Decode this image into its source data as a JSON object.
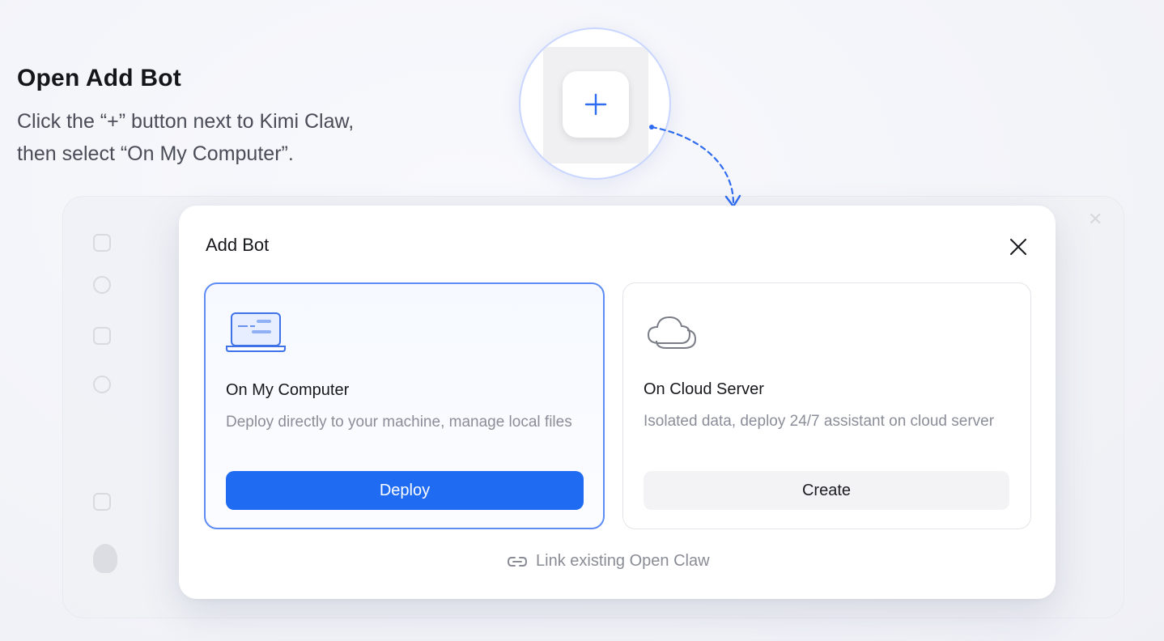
{
  "instruction": {
    "title": "Open Add Bot",
    "line1": "Click the “+” button next to Kimi Claw,",
    "line2": "then select “On My Computer”."
  },
  "zoom": {
    "button_icon": "plus-icon",
    "accent": "#2f6cf0"
  },
  "modal": {
    "title": "Add Bot",
    "close_icon": "close-icon",
    "cards": [
      {
        "id": "computer",
        "icon": "laptop-icon",
        "title": "On My Computer",
        "description": "Deploy directly to your machine, manage local files",
        "button": "Deploy",
        "selected": true
      },
      {
        "id": "cloud",
        "icon": "cloud-icon",
        "title": "On Cloud Server",
        "description": "Isolated data, deploy 24/7 assistant on cloud server",
        "button": "Create",
        "selected": false
      }
    ],
    "link": {
      "icon": "link-icon",
      "label": "Link existing Open Claw"
    }
  },
  "colors": {
    "primary": "#1f6cf2",
    "selected_border": "#5e8cf5",
    "muted_text": "#8b8e98"
  }
}
